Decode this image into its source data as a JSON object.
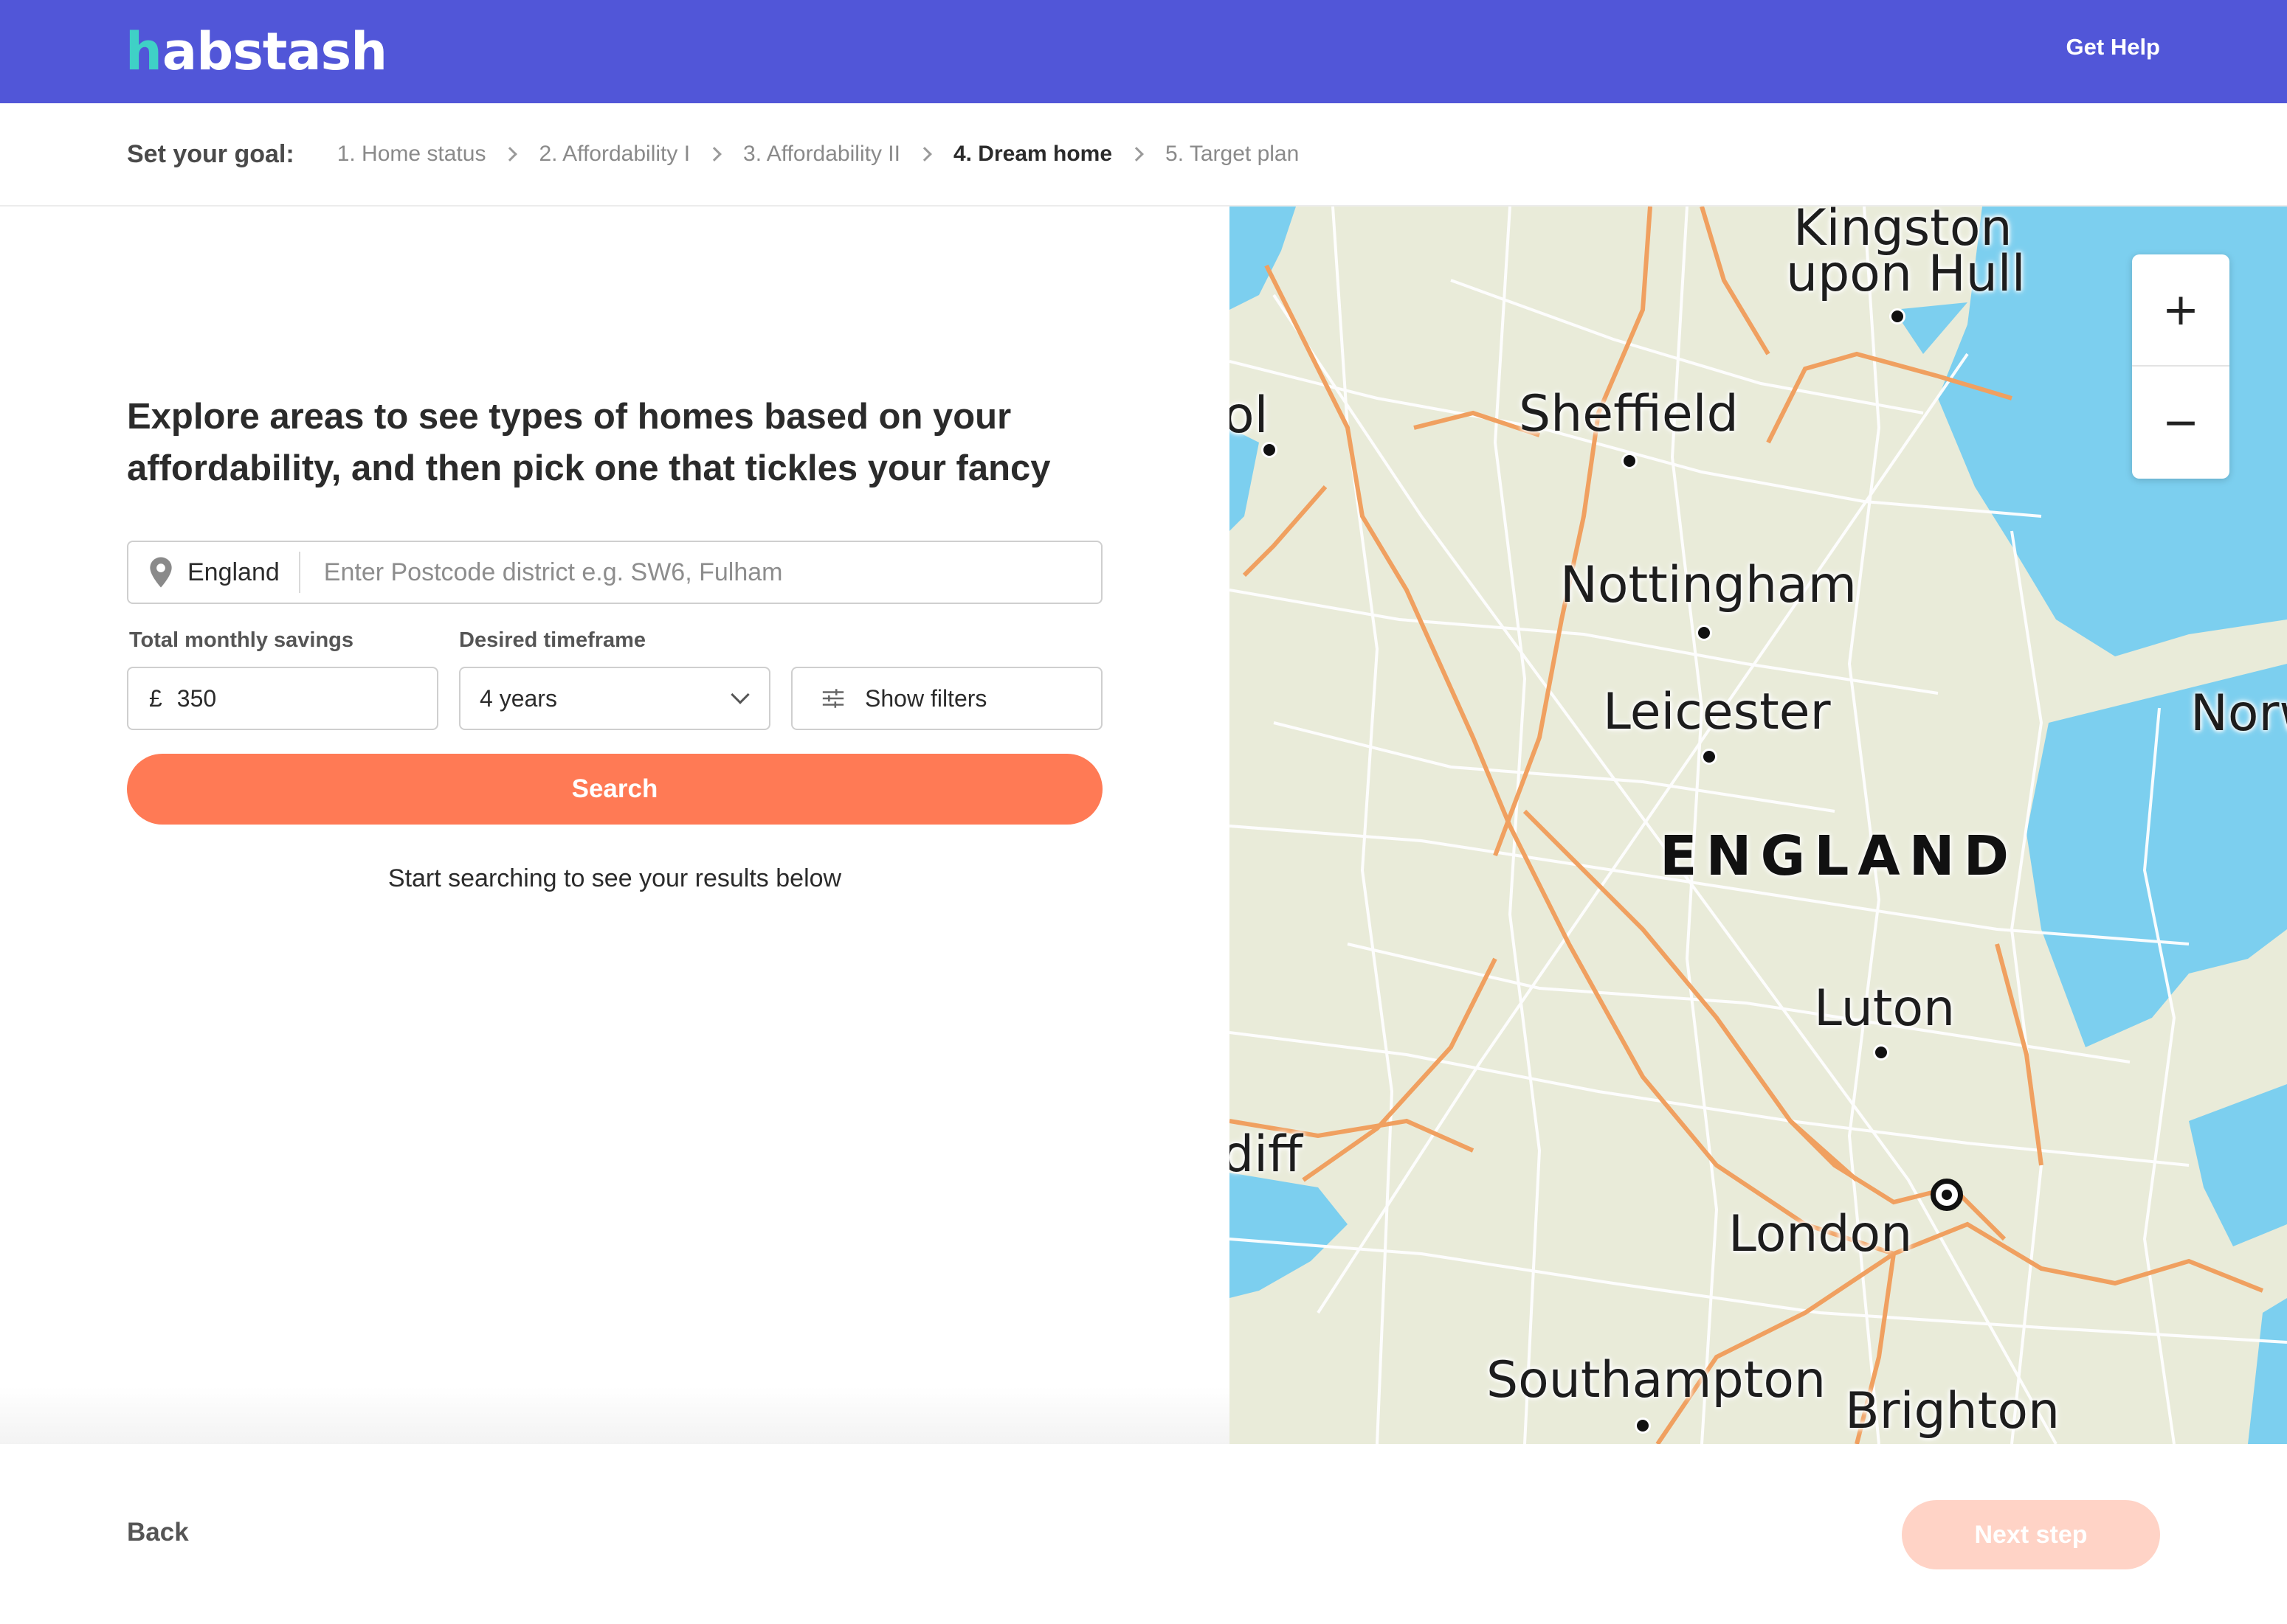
{
  "header": {
    "logo_h": "h",
    "logo_rest": "abstash",
    "help_label": "Get Help"
  },
  "steps": {
    "title": "Set your goal:",
    "items": [
      {
        "label": "1. Home status",
        "active": false
      },
      {
        "label": "2. Affordability I",
        "active": false
      },
      {
        "label": "3. Affordability II",
        "active": false
      },
      {
        "label": "4. Dream home",
        "active": true
      },
      {
        "label": "5. Target plan",
        "active": false
      }
    ]
  },
  "main": {
    "headline": "Explore areas to see types of homes based on your affordability, and then pick one that tickles your fancy",
    "location": {
      "region": "England",
      "placeholder": "Enter Postcode district e.g. SW6, Fulham",
      "icon": "location-pin-icon"
    },
    "savings": {
      "label": "Total monthly savings",
      "currency": "£",
      "value": "350"
    },
    "timeframe": {
      "label": "Desired timeframe",
      "value": "4 years",
      "icon": "chevron-down-icon"
    },
    "filters": {
      "label": "Show filters",
      "icon": "sliders-icon"
    },
    "search_label": "Search",
    "hint": "Start searching to see your results below"
  },
  "map": {
    "cities": {
      "hull_line1": "Kingston",
      "hull_line2": "upon Hull",
      "sheffield": "Sheffield",
      "nottingham": "Nottingham",
      "leicester": "Leicester",
      "luton": "Luton",
      "london": "London",
      "southampton": "Southampton",
      "brighton": "Brighton",
      "cardiff_partial": "diff",
      "liverpool_partial": "ol",
      "norwich_partial": "Norw"
    },
    "country": "ENGLAND",
    "zoom_in": "+",
    "zoom_out": "−",
    "colors": {
      "water": "#7ccfef",
      "land": "#e9ebd9",
      "motorway": "#f0a060",
      "roads": "#ffffff"
    }
  },
  "footer": {
    "back_label": "Back",
    "next_label": "Next step"
  },
  "colors": {
    "brand": "#5156d8",
    "accent": "#ff7a55",
    "accent_disabled": "#ffd3c6",
    "logo_accent": "#3fd1c6"
  }
}
